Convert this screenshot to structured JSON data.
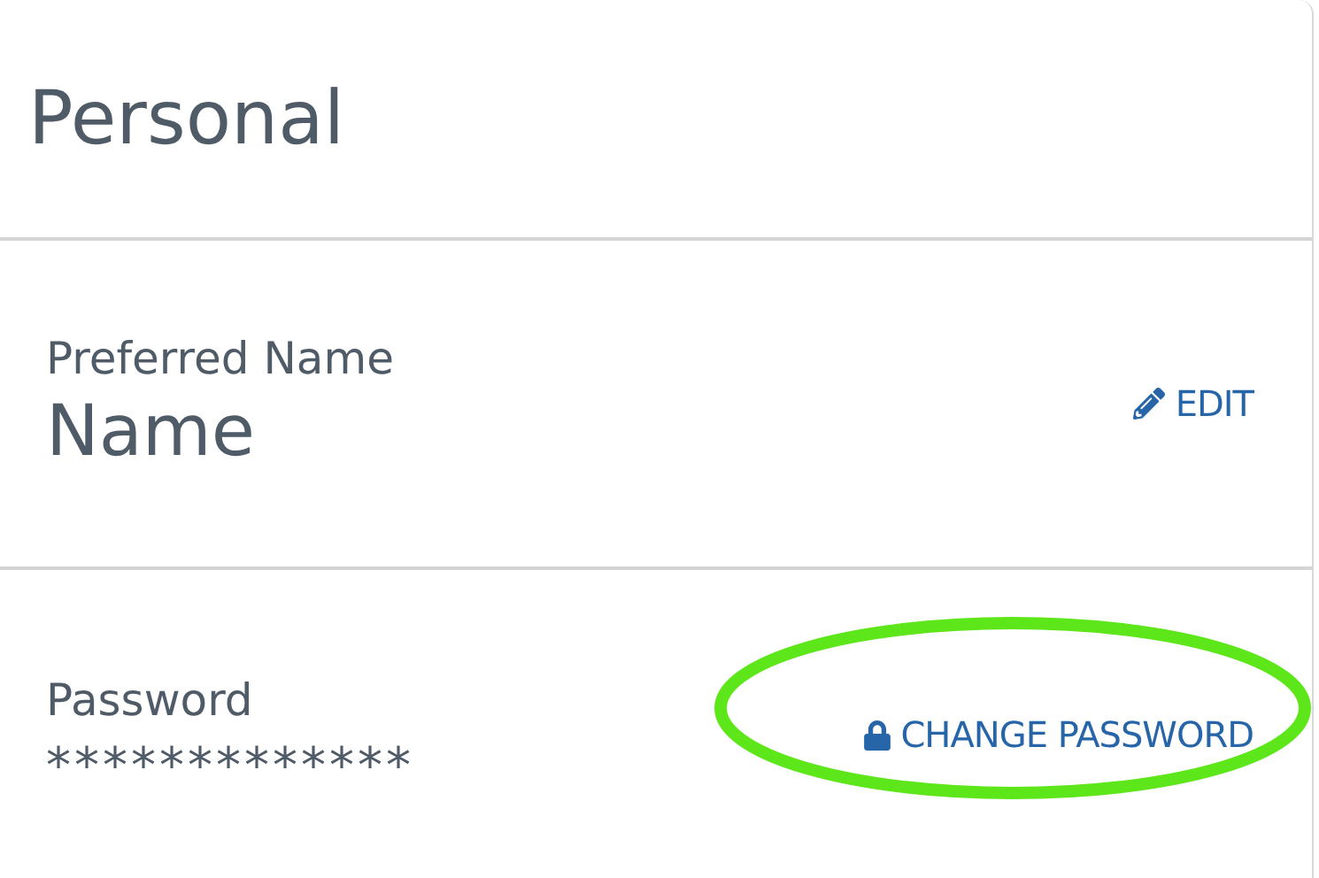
{
  "section_title": "Personal",
  "fields": [
    {
      "label": "Preferred Name",
      "value": "Name",
      "kind": "text",
      "action": {
        "kind": "edit",
        "label": "EDIT",
        "highlighted": false
      }
    },
    {
      "label": "Password",
      "value": "*************",
      "kind": "secret",
      "action": {
        "kind": "password",
        "label": "CHANGE PASSWORD",
        "highlighted": true
      }
    }
  ]
}
